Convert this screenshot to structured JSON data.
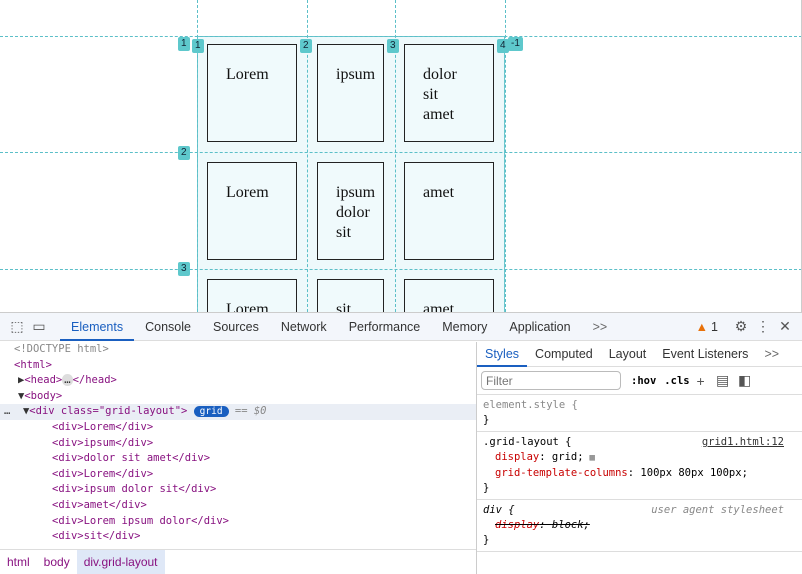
{
  "viewport": {
    "badges": {
      "row_lines": [
        "1",
        "2",
        "3"
      ],
      "col_lines": [
        "1",
        "2",
        "3",
        "4"
      ],
      "neg": "-1"
    },
    "cells": [
      [
        "Lorem"
      ],
      [
        "ipsum"
      ],
      [
        "dolor",
        "sit",
        "amet"
      ],
      [
        "Lorem"
      ],
      [
        "ipsum",
        "dolor",
        "sit"
      ],
      [
        "amet"
      ],
      [
        "Lorem"
      ],
      [
        "sit"
      ],
      [
        "amet"
      ]
    ]
  },
  "devtools": {
    "tabs": [
      "Elements",
      "Console",
      "Sources",
      "Network",
      "Performance",
      "Memory",
      "Application"
    ],
    "active_tab": "Elements",
    "more": ">>",
    "warnings": "1",
    "dom": {
      "doctype": "<!DOCTYPE html>",
      "html": "<html>",
      "head": "<head>",
      "head_close": "</head>",
      "body": "<body>",
      "div_open": "<div class=\"grid-layout\">",
      "grid_badge": "grid",
      "eq": "== $0",
      "children": [
        "<div>Lorem</div>",
        "<div>ipsum</div>",
        "<div>dolor sit amet</div>",
        "<div>Lorem</div>",
        "<div>ipsum dolor sit</div>",
        "<div>amet</div>",
        "<div>Lorem ipsum dolor</div>",
        "<div>sit</div>"
      ]
    },
    "breadcrumbs": [
      "html",
      "body",
      "div.grid-layout"
    ],
    "sidebar": {
      "tabs": [
        "Styles",
        "Computed",
        "Layout",
        "Event Listeners"
      ],
      "more": ">>",
      "filter_placeholder": "Filter",
      "hov": ":hov",
      "cls": ".cls",
      "rules": [
        {
          "selector": "element.style {",
          "close": "}"
        },
        {
          "selector": ".grid-layout {",
          "source": "grid1.html:12",
          "props": [
            {
              "name": "display",
              "value": "grid;"
            },
            {
              "name": "grid-template-columns",
              "value": "100px 80px 100px;"
            }
          ],
          "close": "}"
        },
        {
          "selector": "div {",
          "source": "user agent stylesheet",
          "props": [
            {
              "name": "display",
              "value": "block;"
            }
          ],
          "close": "}"
        }
      ]
    }
  }
}
